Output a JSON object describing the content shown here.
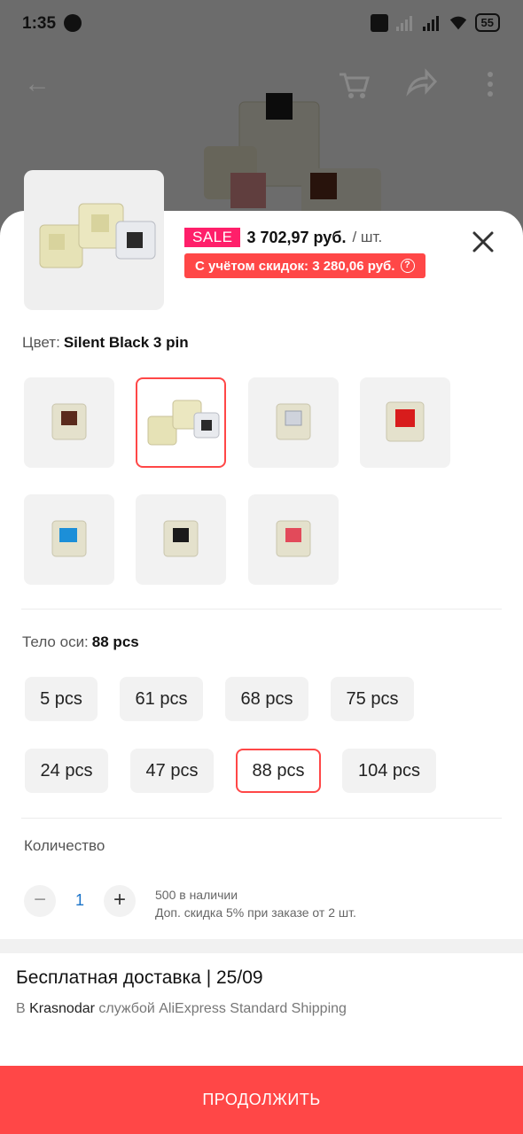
{
  "status_bar": {
    "time": "1:35",
    "battery": "55",
    "icons": [
      "telegram-icon",
      "volte-icon",
      "signal-icon",
      "wifi-icon",
      "battery-icon"
    ]
  },
  "top_nav": {
    "icons": [
      "back-arrow-icon",
      "cart-icon",
      "share-icon",
      "more-vert-icon"
    ]
  },
  "product": {
    "sale_badge": "SALE",
    "price": "3 702,97 руб.",
    "unit": "/ шт.",
    "discount_text": "С учётом скидок: 3 280,06 руб."
  },
  "color_option": {
    "label": "Цвет:",
    "selected": "Silent Black 3 pin",
    "swatches": [
      {
        "name": "brown",
        "stem": "#5a2a1c"
      },
      {
        "name": "silent-black-3-pin",
        "stem": "#222"
      },
      {
        "name": "clear",
        "stem": "#cfd3dc"
      },
      {
        "name": "red",
        "stem": "#d81c1c"
      },
      {
        "name": "blue",
        "stem": "#1c8fd8"
      },
      {
        "name": "black",
        "stem": "#1a1a1a"
      },
      {
        "name": "pink-red",
        "stem": "#e24a5a"
      }
    ]
  },
  "axis_option": {
    "label": "Тело оси:",
    "selected": "88 pcs",
    "options": [
      "5 pcs",
      "61 pcs",
      "68 pcs",
      "75 pcs",
      "24 pcs",
      "47 pcs",
      "88 pcs",
      "104 pcs"
    ]
  },
  "quantity": {
    "label": "Количество",
    "minus": "−",
    "value": "1",
    "plus": "+",
    "stock": "500 в наличии",
    "bulk_discount": "Доп. скидка 5% при заказе от 2 шт."
  },
  "delivery": {
    "title": "Бесплатная доставка | 25/09",
    "prefix": "В",
    "city": "Krasnodar",
    "suffix": "службой AliExpress Standard Shipping"
  },
  "continue_button": "ПРОДОЛЖИТЬ",
  "colors": {
    "accent": "#ff4747",
    "sale": "#ff1f6a",
    "quantity_value": "#1a73c9"
  }
}
